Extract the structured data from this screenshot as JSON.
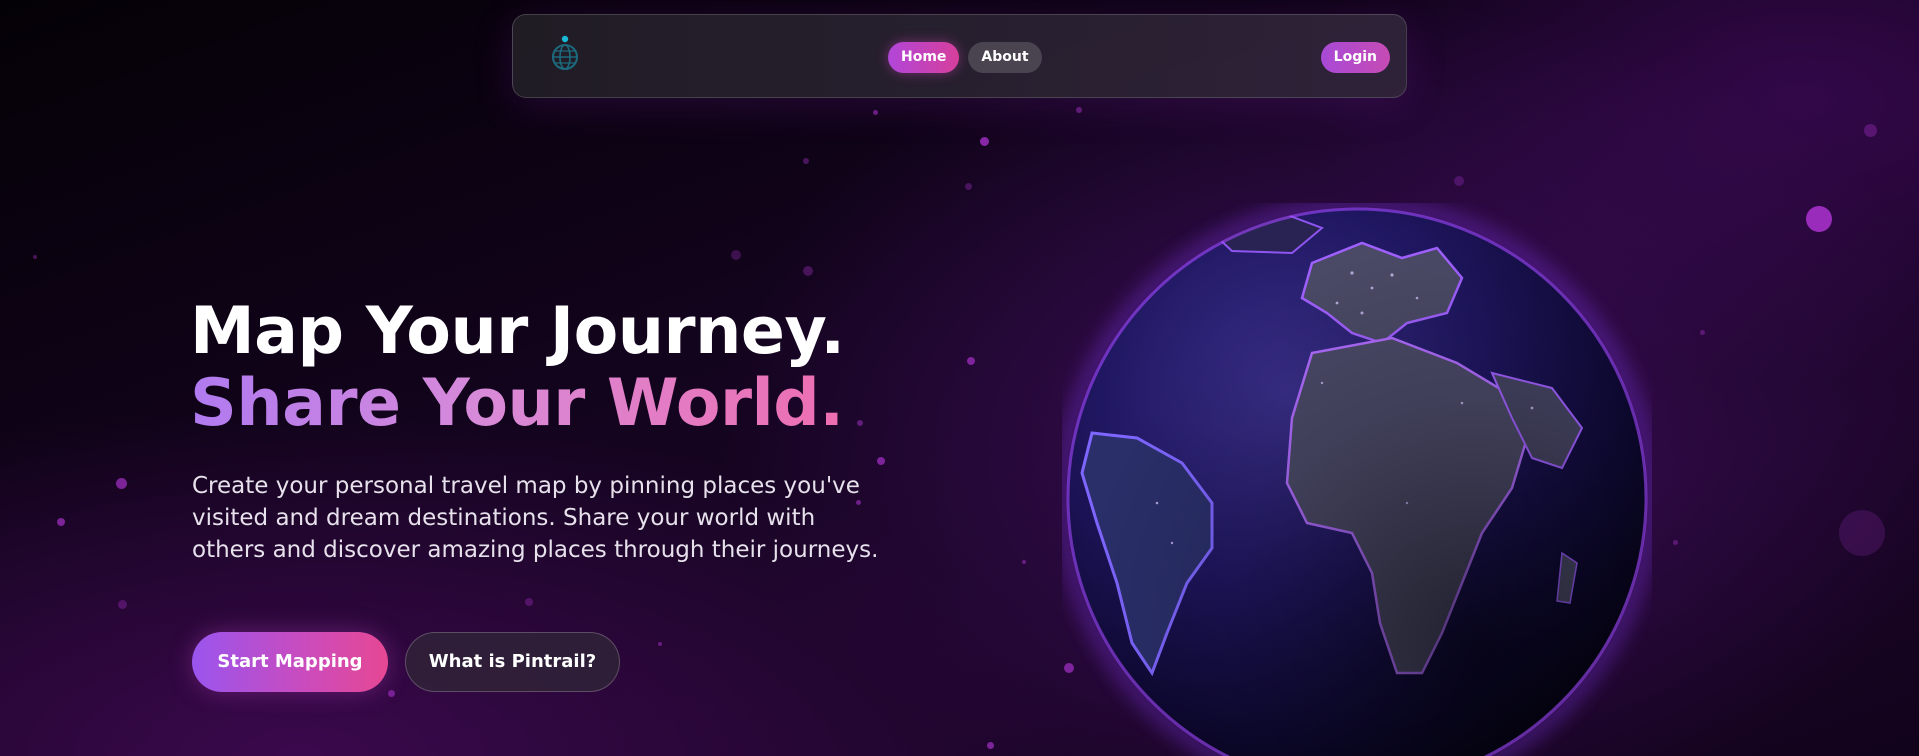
{
  "nav": {
    "logo_icon": "globe-pin-icon",
    "items": [
      {
        "label": "Home",
        "active": true
      },
      {
        "label": "About",
        "active": false
      }
    ],
    "login_label": "Login"
  },
  "hero": {
    "title_line1": "Map Your Journey.",
    "title_line2": "Share Your World.",
    "description": "Create your personal travel map by pinning places you've visited and dream destinations. Share your world with others and discover amazing places through their journeys.",
    "primary_cta": "Start Mapping",
    "secondary_cta": "What is Pintrail?"
  },
  "globe": {
    "icon": "earth-globe-illustration"
  },
  "colors": {
    "accent_purple": "#a84ad6",
    "accent_pink": "#e64893",
    "background": "#14041f",
    "globe_glow": "#7b3cff"
  }
}
